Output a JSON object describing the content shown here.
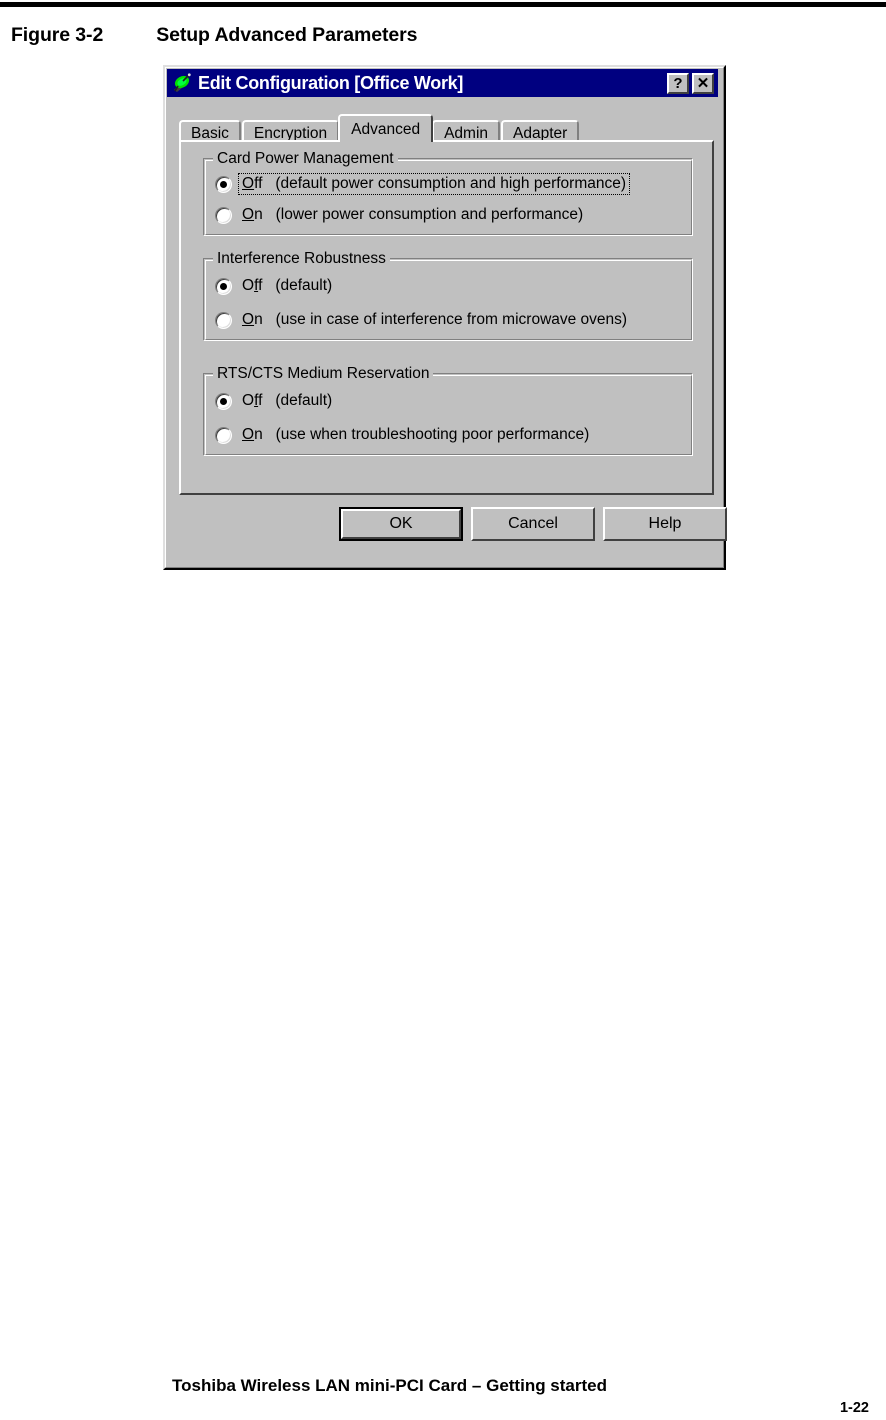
{
  "page": {
    "figure_label": "Figure 3-2",
    "figure_title": "Setup Advanced Parameters",
    "footer_text": "Toshiba Wireless LAN mini-PCI Card – Getting started",
    "page_number": "1-22"
  },
  "dialog": {
    "title": "Edit Configuration [Office Work]",
    "icon": "satellite-dish-icon",
    "title_bar_color": "#000080",
    "face_color": "#c0c0c0",
    "help_button": "?",
    "close_button": "✕",
    "tabs": [
      {
        "label": "Basic",
        "selected": false
      },
      {
        "label": "Encryption",
        "selected": false
      },
      {
        "label": "Advanced",
        "selected": true
      },
      {
        "label": "Admin",
        "selected": false
      },
      {
        "label": "Adapter",
        "selected": false
      }
    ],
    "groups": [
      {
        "title": "Card Power Management",
        "options": [
          {
            "value": "Off",
            "accel": "ff",
            "accel_char": "f",
            "description": "(default power consumption and high performance)",
            "selected": true,
            "focused": true
          },
          {
            "value": "On",
            "accel_char": "O",
            "description": "(lower power consumption and performance)",
            "selected": false,
            "focused": false
          }
        ]
      },
      {
        "title": "Interference Robustness",
        "options": [
          {
            "value": "Off",
            "accel_char": "f",
            "description": "(default)",
            "selected": true,
            "focused": false
          },
          {
            "value": "On",
            "accel_char": "O",
            "description": "(use in case of interference from microwave ovens)",
            "selected": false,
            "focused": false
          }
        ]
      },
      {
        "title": "RTS/CTS Medium Reservation",
        "options": [
          {
            "value": "Off",
            "accel_char": "f",
            "description": "(default)",
            "selected": true,
            "focused": false
          },
          {
            "value": "On",
            "accel_char": "O",
            "description": "(use when troubleshooting poor performance)",
            "selected": false,
            "focused": false
          }
        ]
      }
    ],
    "buttons": {
      "ok": "OK",
      "cancel": "Cancel",
      "help": "Help"
    }
  }
}
